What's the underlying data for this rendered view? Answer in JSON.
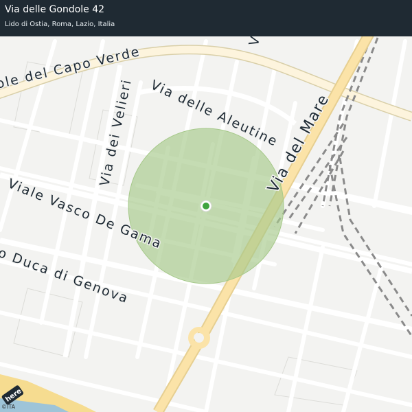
{
  "header": {
    "title": "Via delle Gondole 42",
    "subtitle": "Lido di Ostia, Roma, Lazio, Italia"
  },
  "streets": {
    "capo_verde": "ole del Capo Verde",
    "aleutine": "Via delle Aleutine",
    "velieri": "Via dei Velieri",
    "del_mare": "Via del Mare",
    "vasco_de_gama": "Viale Vasco De Gama",
    "duca_genova": "o Duca di Genova",
    "top_partial": "Via del"
  },
  "logo": "here",
  "copyright": "©ITA",
  "colors": {
    "accuracy_fill": "#a6c98a",
    "location_dot": "#3fa43f",
    "main_road": "#fbe3a8",
    "header_bg": "#1f2a33"
  },
  "icons": {
    "location": "location-dot-icon",
    "oneway": "oneway-arrow-icon"
  }
}
